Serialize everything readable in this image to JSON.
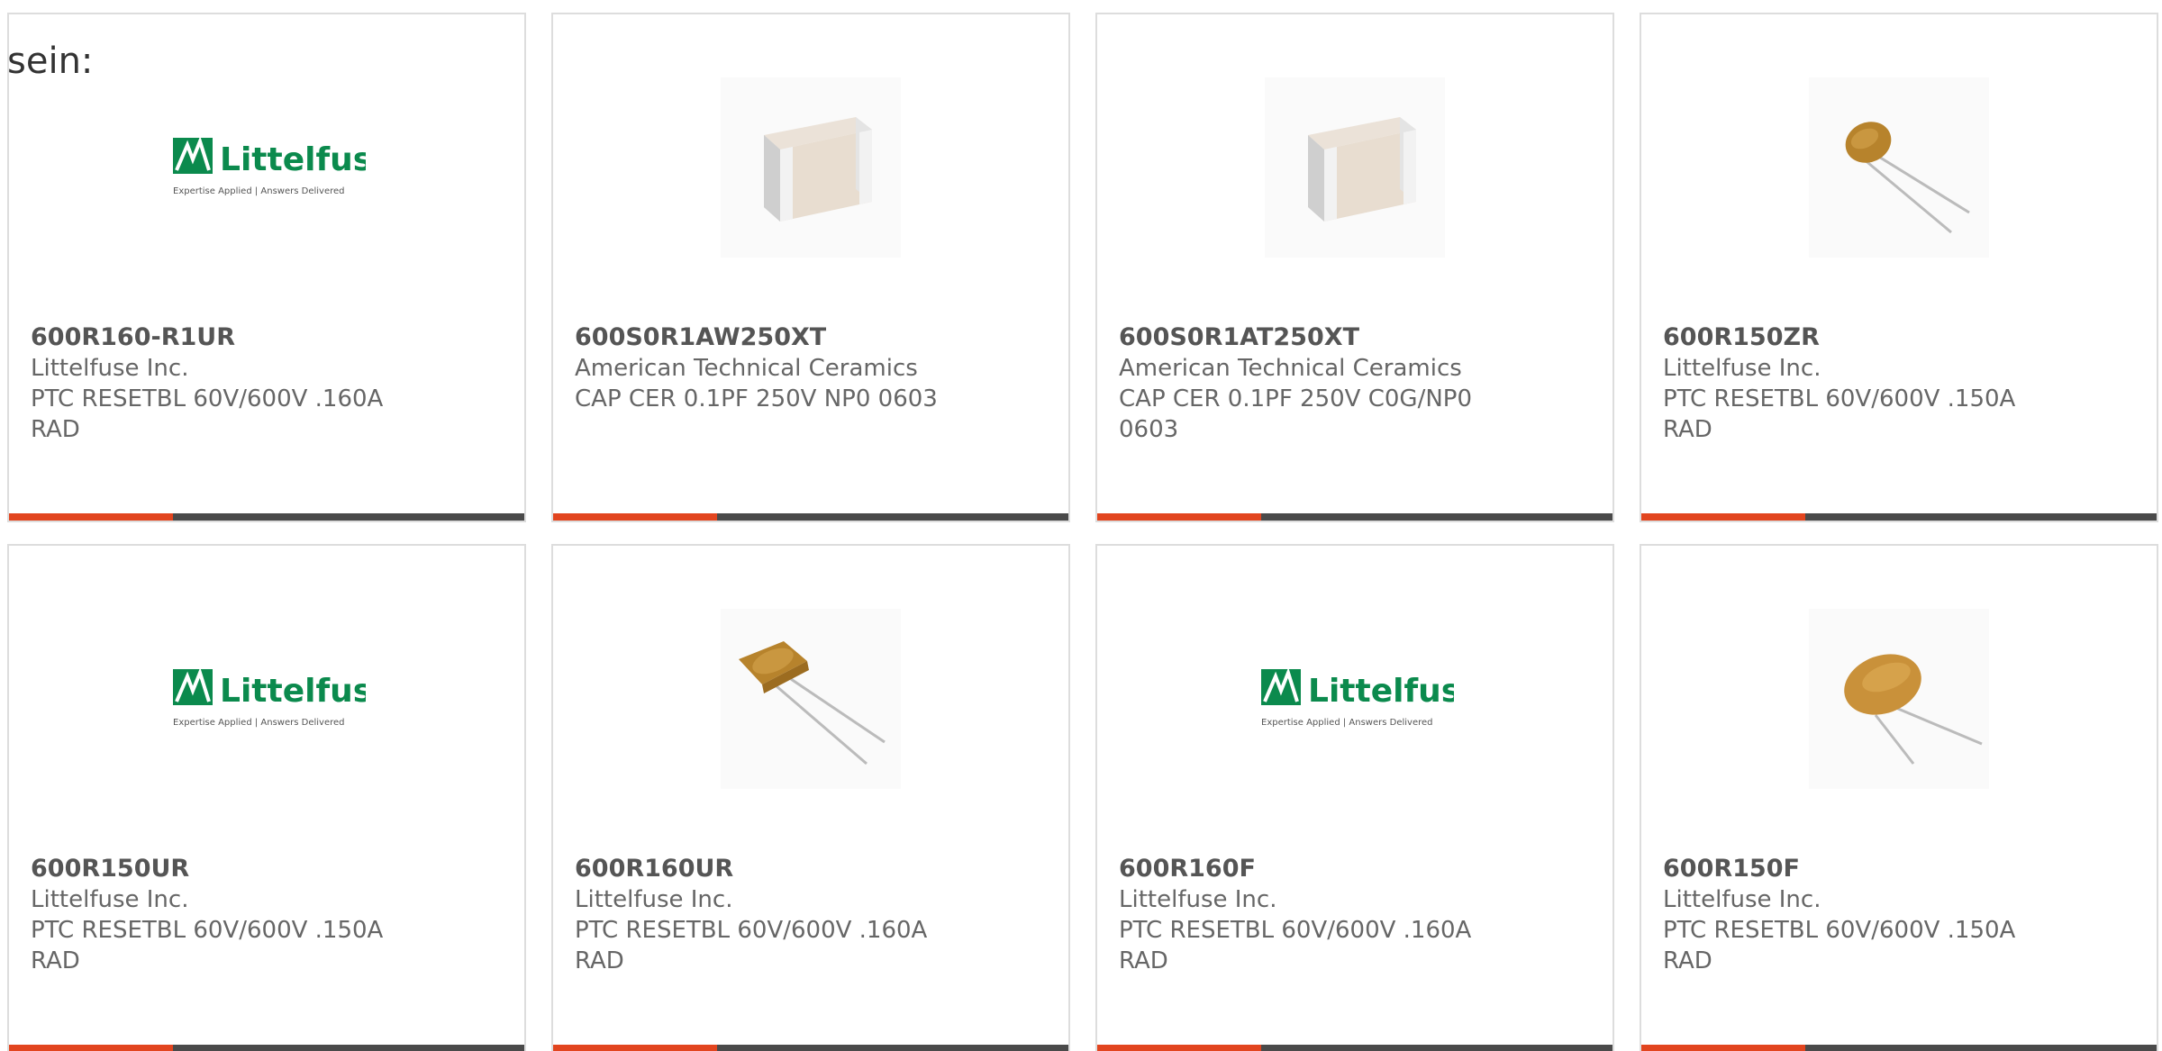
{
  "intro_text": "sein:",
  "colors": {
    "accent_bar": "#e2451f",
    "dark_bar": "#4a4a4a",
    "logo_green": "#0b8a4d"
  },
  "logo": {
    "brand": "Littelfuse",
    "tagline": "Expertise Applied | Answers Delivered"
  },
  "products": [
    {
      "part": "600R160-R1UR",
      "manufacturer": "Littelfuse Inc.",
      "desc_line1": "PTC RESETBL 60V/600V .160A",
      "desc_line2": "RAD",
      "image": "littelfuse-logo"
    },
    {
      "part": "600S0R1AW250XT",
      "manufacturer": "American Technical Ceramics",
      "desc_line1": "CAP CER 0.1PF 250V NP0 0603",
      "desc_line2": "",
      "image": "ceramic-chip-capacitor"
    },
    {
      "part": "600S0R1AT250XT",
      "manufacturer": "American Technical Ceramics",
      "desc_line1": "CAP CER 0.1PF 250V C0G/NP0",
      "desc_line2": "0603",
      "image": "ceramic-chip-capacitor"
    },
    {
      "part": "600R150ZR",
      "manufacturer": "Littelfuse Inc.",
      "desc_line1": "PTC RESETBL 60V/600V .150A",
      "desc_line2": "RAD",
      "image": "radial-ptc-fuse"
    },
    {
      "part": "600R150UR",
      "manufacturer": "Littelfuse Inc.",
      "desc_line1": "PTC RESETBL 60V/600V .150A",
      "desc_line2": "RAD",
      "image": "littelfuse-logo"
    },
    {
      "part": "600R160UR",
      "manufacturer": "Littelfuse Inc.",
      "desc_line1": "PTC RESETBL 60V/600V .160A",
      "desc_line2": "RAD",
      "image": "radial-ptc-fuse"
    },
    {
      "part": "600R160F",
      "manufacturer": "Littelfuse Inc.",
      "desc_line1": "PTC RESETBL 60V/600V .160A",
      "desc_line2": "RAD",
      "image": "littelfuse-logo"
    },
    {
      "part": "600R150F",
      "manufacturer": "Littelfuse Inc.",
      "desc_line1": "PTC RESETBL 60V/600V .150A",
      "desc_line2": "RAD",
      "image": "radial-ptc-fuse-round"
    }
  ]
}
